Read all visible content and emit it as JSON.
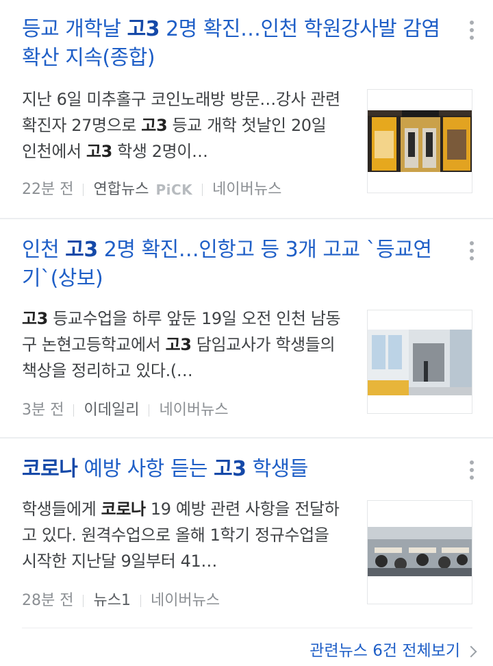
{
  "articles": [
    {
      "title_parts": [
        "등교 개학날 ",
        "고3",
        " 2명 확진…인천 학원강사발 감염 확산 지속(종합)"
      ],
      "desc_parts": [
        "지난 6일 미추홀구 코인노래방 방문…강사 관련 확진자 27명으로 ",
        "고3",
        " 등교 개학 첫날인 20일 인천에서 ",
        "고3",
        " 학생 2명이…"
      ],
      "time": "22분 전",
      "press": "연합뉴스",
      "badge": "PiCK",
      "source": "네이버뉴스",
      "thumb_icon": "coin-karaoke-storefront-photo"
    },
    {
      "title_parts": [
        "인천 ",
        "고3",
        " 2명 확진…인항고 등 3개 고교 `등교연기`(상보)"
      ],
      "desc_parts": [
        "고3",
        " 등교수업을 하루 앞둔 19일 오전 인천 남동구 논현고등학교에서 ",
        "고3",
        " 담임교사가 학생들의 책상을 정리하고 있다.(…"
      ],
      "time": "3분 전",
      "press": "이데일리",
      "source": "네이버뉴스",
      "thumb_icon": "classroom-hallway-photo"
    },
    {
      "title_parts": [
        "코로나",
        " 예방 사항 듣는 ",
        "고3",
        " 학생들"
      ],
      "desc_parts": [
        "학생들에게 ",
        "코로나",
        " 19 예방 관련 사항을 전달하고 있다. 원격수업으로 올해 1학기 정규수업을 시작한 지난달 9일부터 41…"
      ],
      "time": "28분 전",
      "press": "뉴스1",
      "source": "네이버뉴스",
      "thumb_icon": "students-in-classroom-photo"
    }
  ],
  "related_link": "관련뉴스 6건 전체보기",
  "colors": {
    "title": "#1f5fc7",
    "meta": "#8b8f93",
    "separator": "#eceef0"
  }
}
